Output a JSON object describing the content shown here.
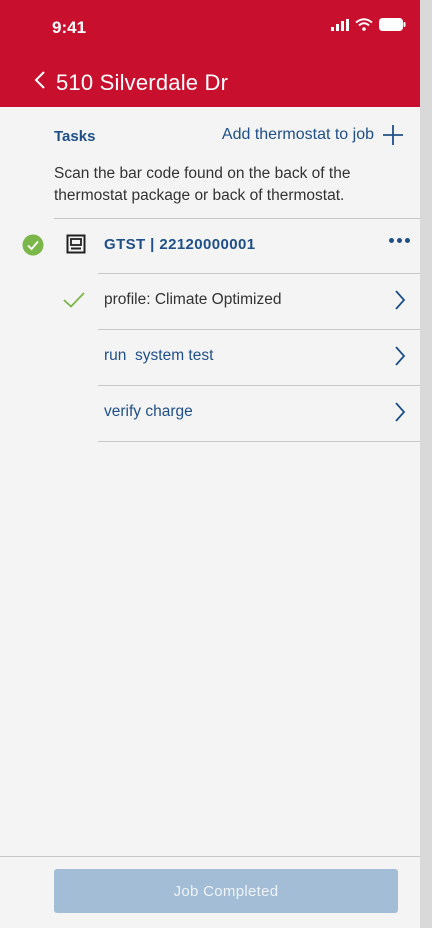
{
  "status_bar": {
    "time": "9:41"
  },
  "header": {
    "title": "510 Silverdale Dr"
  },
  "tasks_section": {
    "title": "Tasks",
    "add_label": "Add thermostat to job",
    "instructions": "Scan the bar code found on the back of the thermostat package or back of thermostat."
  },
  "device": {
    "name": "GTST  |  22120000001",
    "status": "complete",
    "tasks": [
      {
        "label": "profile: Climate Optimized",
        "done": true
      },
      {
        "label": "run  system test",
        "done": false
      },
      {
        "label": "verify charge",
        "done": false
      }
    ]
  },
  "footer": {
    "button_label": "Job Completed",
    "button_state": "disabled"
  },
  "colors": {
    "header": "#c8102e",
    "accent_text": "#1f4f87",
    "success": "#7ab648",
    "button_disabled": "#a3bdd6"
  },
  "icons": [
    "signal-icon",
    "wifi-icon",
    "battery-icon",
    "back-chevron-icon",
    "plus-icon",
    "check-circle-icon",
    "thermostat-icon",
    "more-dots-icon",
    "check-icon",
    "chevron-right-icon"
  ]
}
